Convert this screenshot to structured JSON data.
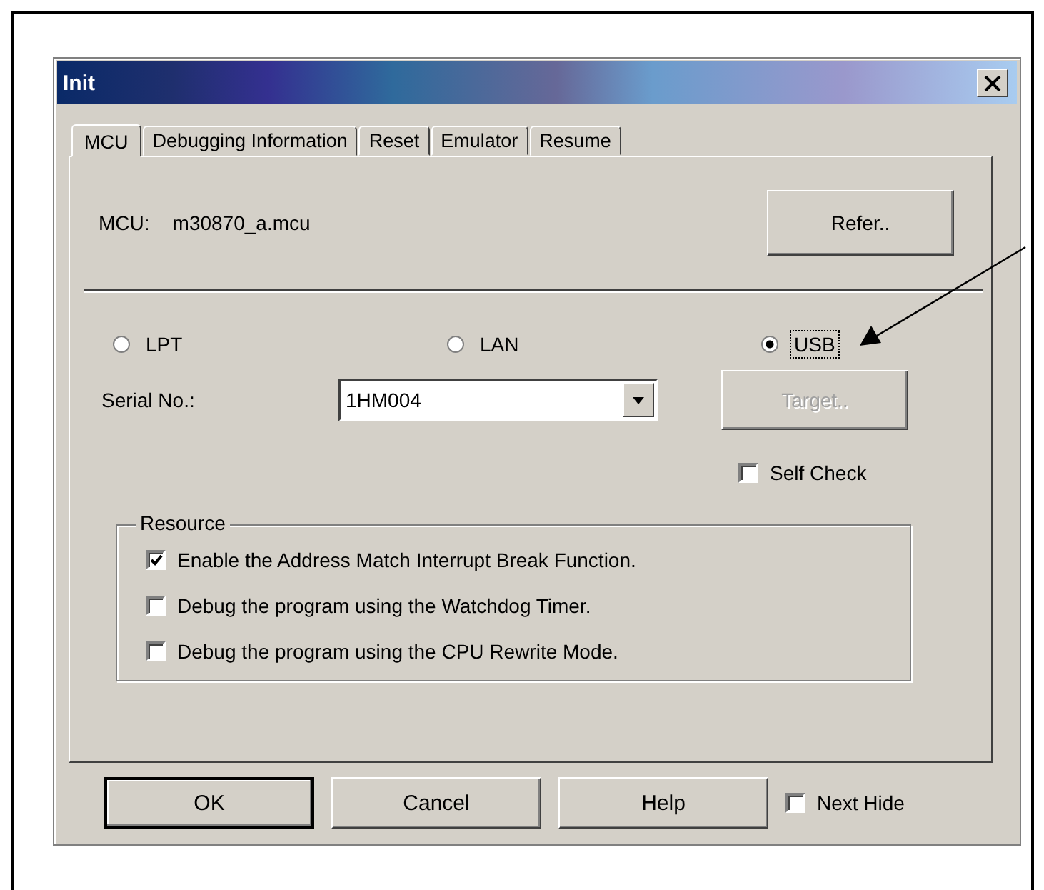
{
  "window": {
    "title": "Init"
  },
  "tabs": [
    {
      "label": "MCU",
      "selected": true
    },
    {
      "label": "Debugging Information",
      "selected": false
    },
    {
      "label": "Reset",
      "selected": false
    },
    {
      "label": "Emulator",
      "selected": false
    },
    {
      "label": "Resume",
      "selected": false
    }
  ],
  "mcu": {
    "label": "MCU:",
    "value": "m30870_a.mcu",
    "button": "Refer.."
  },
  "connections": [
    {
      "label": "LPT",
      "selected": false,
      "focused": false
    },
    {
      "label": "LAN",
      "selected": false,
      "focused": false
    },
    {
      "label": "USB",
      "selected": true,
      "focused": true
    }
  ],
  "serial": {
    "label": "Serial No.:",
    "value": "1HM004"
  },
  "target_button": {
    "label": "Target..",
    "disabled": true
  },
  "self_check": {
    "label": "Self Check",
    "checked": false
  },
  "resource": {
    "title": "Resource",
    "options": [
      {
        "label": "Enable the Address Match Interrupt Break Function.",
        "checked": true
      },
      {
        "label": "Debug the program using the Watchdog Timer.",
        "checked": false
      },
      {
        "label": "Debug the program using the CPU Rewrite Mode.",
        "checked": false
      }
    ]
  },
  "buttons": [
    {
      "label": "OK",
      "default": true
    },
    {
      "label": "Cancel",
      "default": false
    },
    {
      "label": "Help",
      "default": false
    }
  ],
  "next_hide": {
    "label": "Next Hide",
    "checked": false
  }
}
